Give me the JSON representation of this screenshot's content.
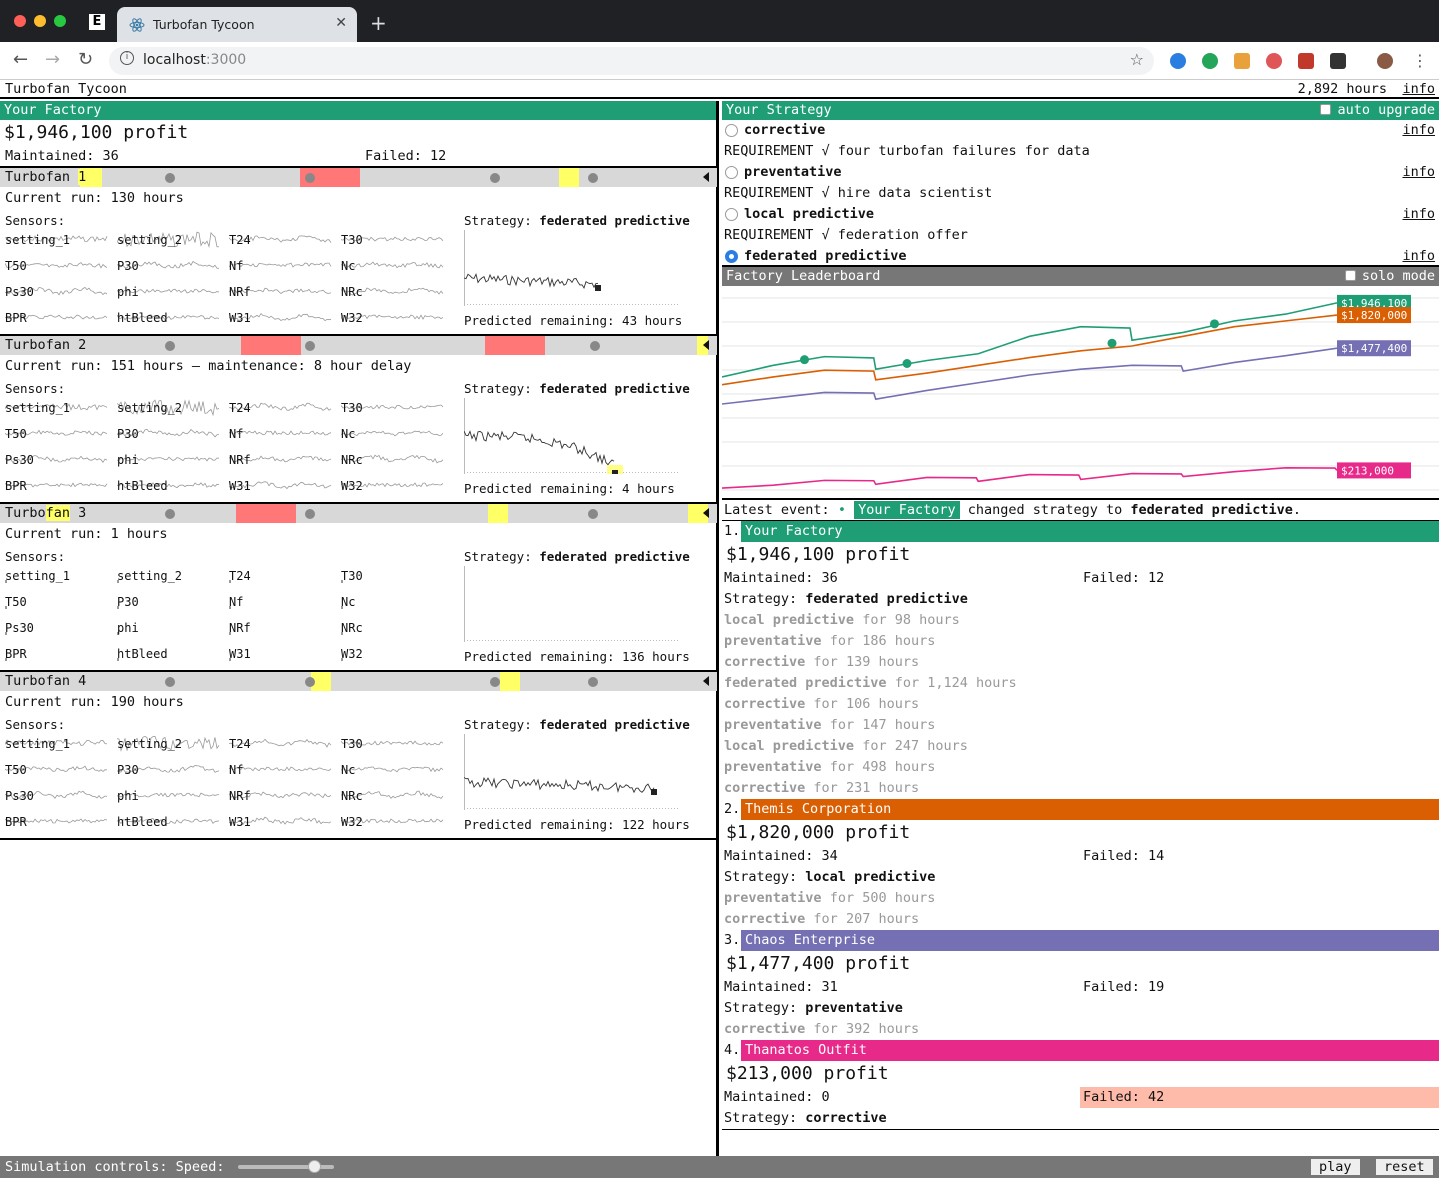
{
  "browser": {
    "tab_title": "Turbofan Tycoon",
    "url_host": "localhost",
    "url_port": ":3000"
  },
  "app": {
    "title": "Turbofan Tycoon",
    "hours": "2,892 hours",
    "info": "info"
  },
  "factory": {
    "header": "Your Factory",
    "profit": "$1,946,100 profit",
    "maintained": "Maintained: 36",
    "failed": "Failed: 12",
    "sensors_label": "Sensors:",
    "sensor_names": [
      "setting_1",
      "setting_2",
      "T24",
      "T30",
      "T50",
      "P30",
      "Nf",
      "Nc",
      "Ps30",
      "phi",
      "NRf",
      "NRc",
      "BPR",
      "htBleed",
      "W31",
      "W32"
    ],
    "strategy_label": "Strategy:",
    "turbofans": [
      {
        "name_a": "Turbofan ",
        "name_b": "1",
        "name_c": "",
        "run": "Current run: 130 hours",
        "strategy": "federated predictive",
        "predicted": "Predicted remaining: 43 hours",
        "rul_fill": 0.62
      },
      {
        "name_a": "Turbofan 2",
        "name_b": "",
        "name_c": "",
        "run": "Current run: 151 hours – maintenance: 8 hour delay",
        "strategy": "federated predictive",
        "predicted": "Predicted remaining: 4 hours",
        "rul_fill": 0.7
      },
      {
        "name_a": "Turbo",
        "name_b": "fan",
        "name_c": " 3",
        "run": "Current run: 1 hours",
        "strategy": "federated predictive",
        "predicted": "Predicted remaining: 136 hours",
        "rul_fill": 0
      },
      {
        "name_a": "Turbofan 4",
        "name_b": "",
        "name_c": "",
        "run": "Current run: 190 hours",
        "strategy": "federated predictive",
        "predicted": "Predicted remaining: 122 hours",
        "rul_fill": 0.88
      }
    ]
  },
  "strategy": {
    "header": "Your Strategy",
    "auto_upgrade": "auto upgrade",
    "options": [
      {
        "label": "corrective",
        "info": "info",
        "requirement": "REQUIREMENT √ four turbofan failures for data",
        "selected": false
      },
      {
        "label": "preventative",
        "info": "info",
        "requirement": "REQUIREMENT √ hire data scientist",
        "selected": false
      },
      {
        "label": "local predictive",
        "info": "info",
        "requirement": "REQUIREMENT √ federation offer",
        "selected": false
      },
      {
        "label": "federated predictive",
        "info": "info",
        "requirement": "",
        "selected": true
      }
    ]
  },
  "leaderboard": {
    "header": "Factory Leaderboard",
    "solo_mode": "solo mode",
    "latest_event_label": "Latest event:",
    "latest_event_company": "Your Factory",
    "latest_event_text": "changed strategy to",
    "latest_event_strategy": "federated predictive",
    "latest_event_end": ".",
    "companies": [
      {
        "rank": "1.",
        "name": "Your Factory",
        "color": "#1f9e76",
        "profit": "$1,946,100 profit",
        "maintained": "Maintained: 36",
        "failed": "Failed: 12",
        "strategy": "federated predictive",
        "history": [
          [
            "local predictive",
            "98"
          ],
          [
            "preventative",
            "186"
          ],
          [
            "corrective",
            "139"
          ],
          [
            "federated predictive",
            "1,124"
          ],
          [
            "corrective",
            "106"
          ],
          [
            "preventative",
            "147"
          ],
          [
            "local predictive",
            "247"
          ],
          [
            "preventative",
            "498"
          ],
          [
            "corrective",
            "231"
          ]
        ]
      },
      {
        "rank": "2.",
        "name": "Themis Corporation",
        "color": "#d95f02",
        "profit": "$1,820,000 profit",
        "maintained": "Maintained: 34",
        "failed": "Failed: 14",
        "strategy": "local predictive",
        "history": [
          [
            "preventative",
            "500"
          ],
          [
            "corrective",
            "207"
          ]
        ]
      },
      {
        "rank": "3.",
        "name": "Chaos Enterprise",
        "color": "#7570b3",
        "profit": "$1,477,400 profit",
        "maintained": "Maintained: 31",
        "failed": "Failed: 19",
        "strategy": "preventative",
        "history": [
          [
            "corrective",
            "392"
          ]
        ]
      },
      {
        "rank": "4.",
        "name": "Thanatos Outfit",
        "color": "#e7298a",
        "profit": "$213,000 profit",
        "maintained": "Maintained: 0",
        "failed": "Failed: 42",
        "strategy": "corrective",
        "history": []
      }
    ]
  },
  "chart_data": {
    "type": "line",
    "series": [
      {
        "name": "Your Factory",
        "color": "#1f9e76",
        "label": "$1,946,100",
        "values": [
          1180,
          1300,
          1390,
          1260,
          1350,
          1420,
          1600,
          1700,
          1560,
          1640,
          1760,
          1830,
          1946
        ]
      },
      {
        "name": "Themis Corporation",
        "color": "#d95f02",
        "label": "$1,820,000",
        "values": [
          1100,
          1180,
          1250,
          1150,
          1220,
          1300,
          1380,
          1450,
          1500,
          1600,
          1700,
          1760,
          1820
        ]
      },
      {
        "name": "Chaos Enterprise",
        "color": "#7570b3",
        "label": "$1,477,400",
        "values": [
          900,
          960,
          1020,
          950,
          1040,
          1120,
          1200,
          1260,
          1300,
          1240,
          1330,
          1400,
          1477
        ]
      },
      {
        "name": "Thanatos Outfit",
        "color": "#e7298a",
        "label": "$213,000",
        "values": [
          30,
          60,
          110,
          70,
          140,
          100,
          170,
          120,
          180,
          150,
          200,
          240,
          213
        ]
      }
    ],
    "ylim": [
      0,
      2100
    ]
  },
  "controls": {
    "label": "Simulation controls: Speed:",
    "speed": 0.8,
    "play": "play",
    "reset": "reset"
  },
  "labels": {
    "for": "for",
    "hours": "hours",
    "strategy": "Strategy:"
  }
}
